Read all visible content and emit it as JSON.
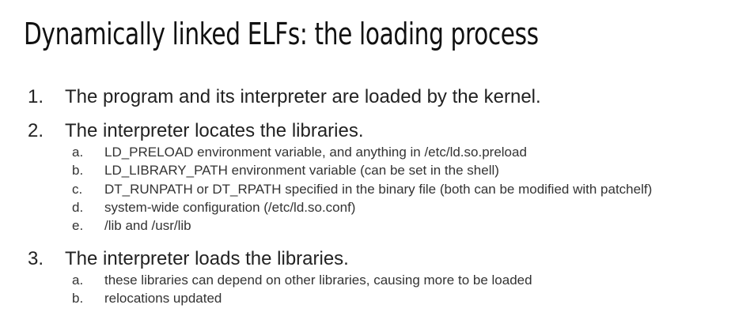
{
  "title": "Dynamically linked ELFs: the loading process",
  "steps": [
    {
      "number": "1.",
      "text": "The program and its interpreter are loaded by the kernel.",
      "subitems": []
    },
    {
      "number": "2.",
      "text": "The interpreter locates the libraries.",
      "subitems": [
        {
          "letter": "a.",
          "text": "LD_PRELOAD environment variable, and anything in /etc/ld.so.preload"
        },
        {
          "letter": "b.",
          "text": "LD_LIBRARY_PATH environment variable (can be set in the shell)"
        },
        {
          "letter": "c.",
          "text": "DT_RUNPATH or DT_RPATH specified in the binary file (both can be modified with patchelf)"
        },
        {
          "letter": "d.",
          "text": "system-wide configuration (/etc/ld.so.conf)"
        },
        {
          "letter": "e.",
          "text": "/lib and /usr/lib"
        }
      ]
    },
    {
      "number": "3.",
      "text": "The interpreter loads the libraries.",
      "subitems": [
        {
          "letter": "a.",
          "text": "these libraries can depend on other libraries, causing more to be loaded"
        },
        {
          "letter": "b.",
          "text": "relocations updated"
        }
      ]
    }
  ]
}
